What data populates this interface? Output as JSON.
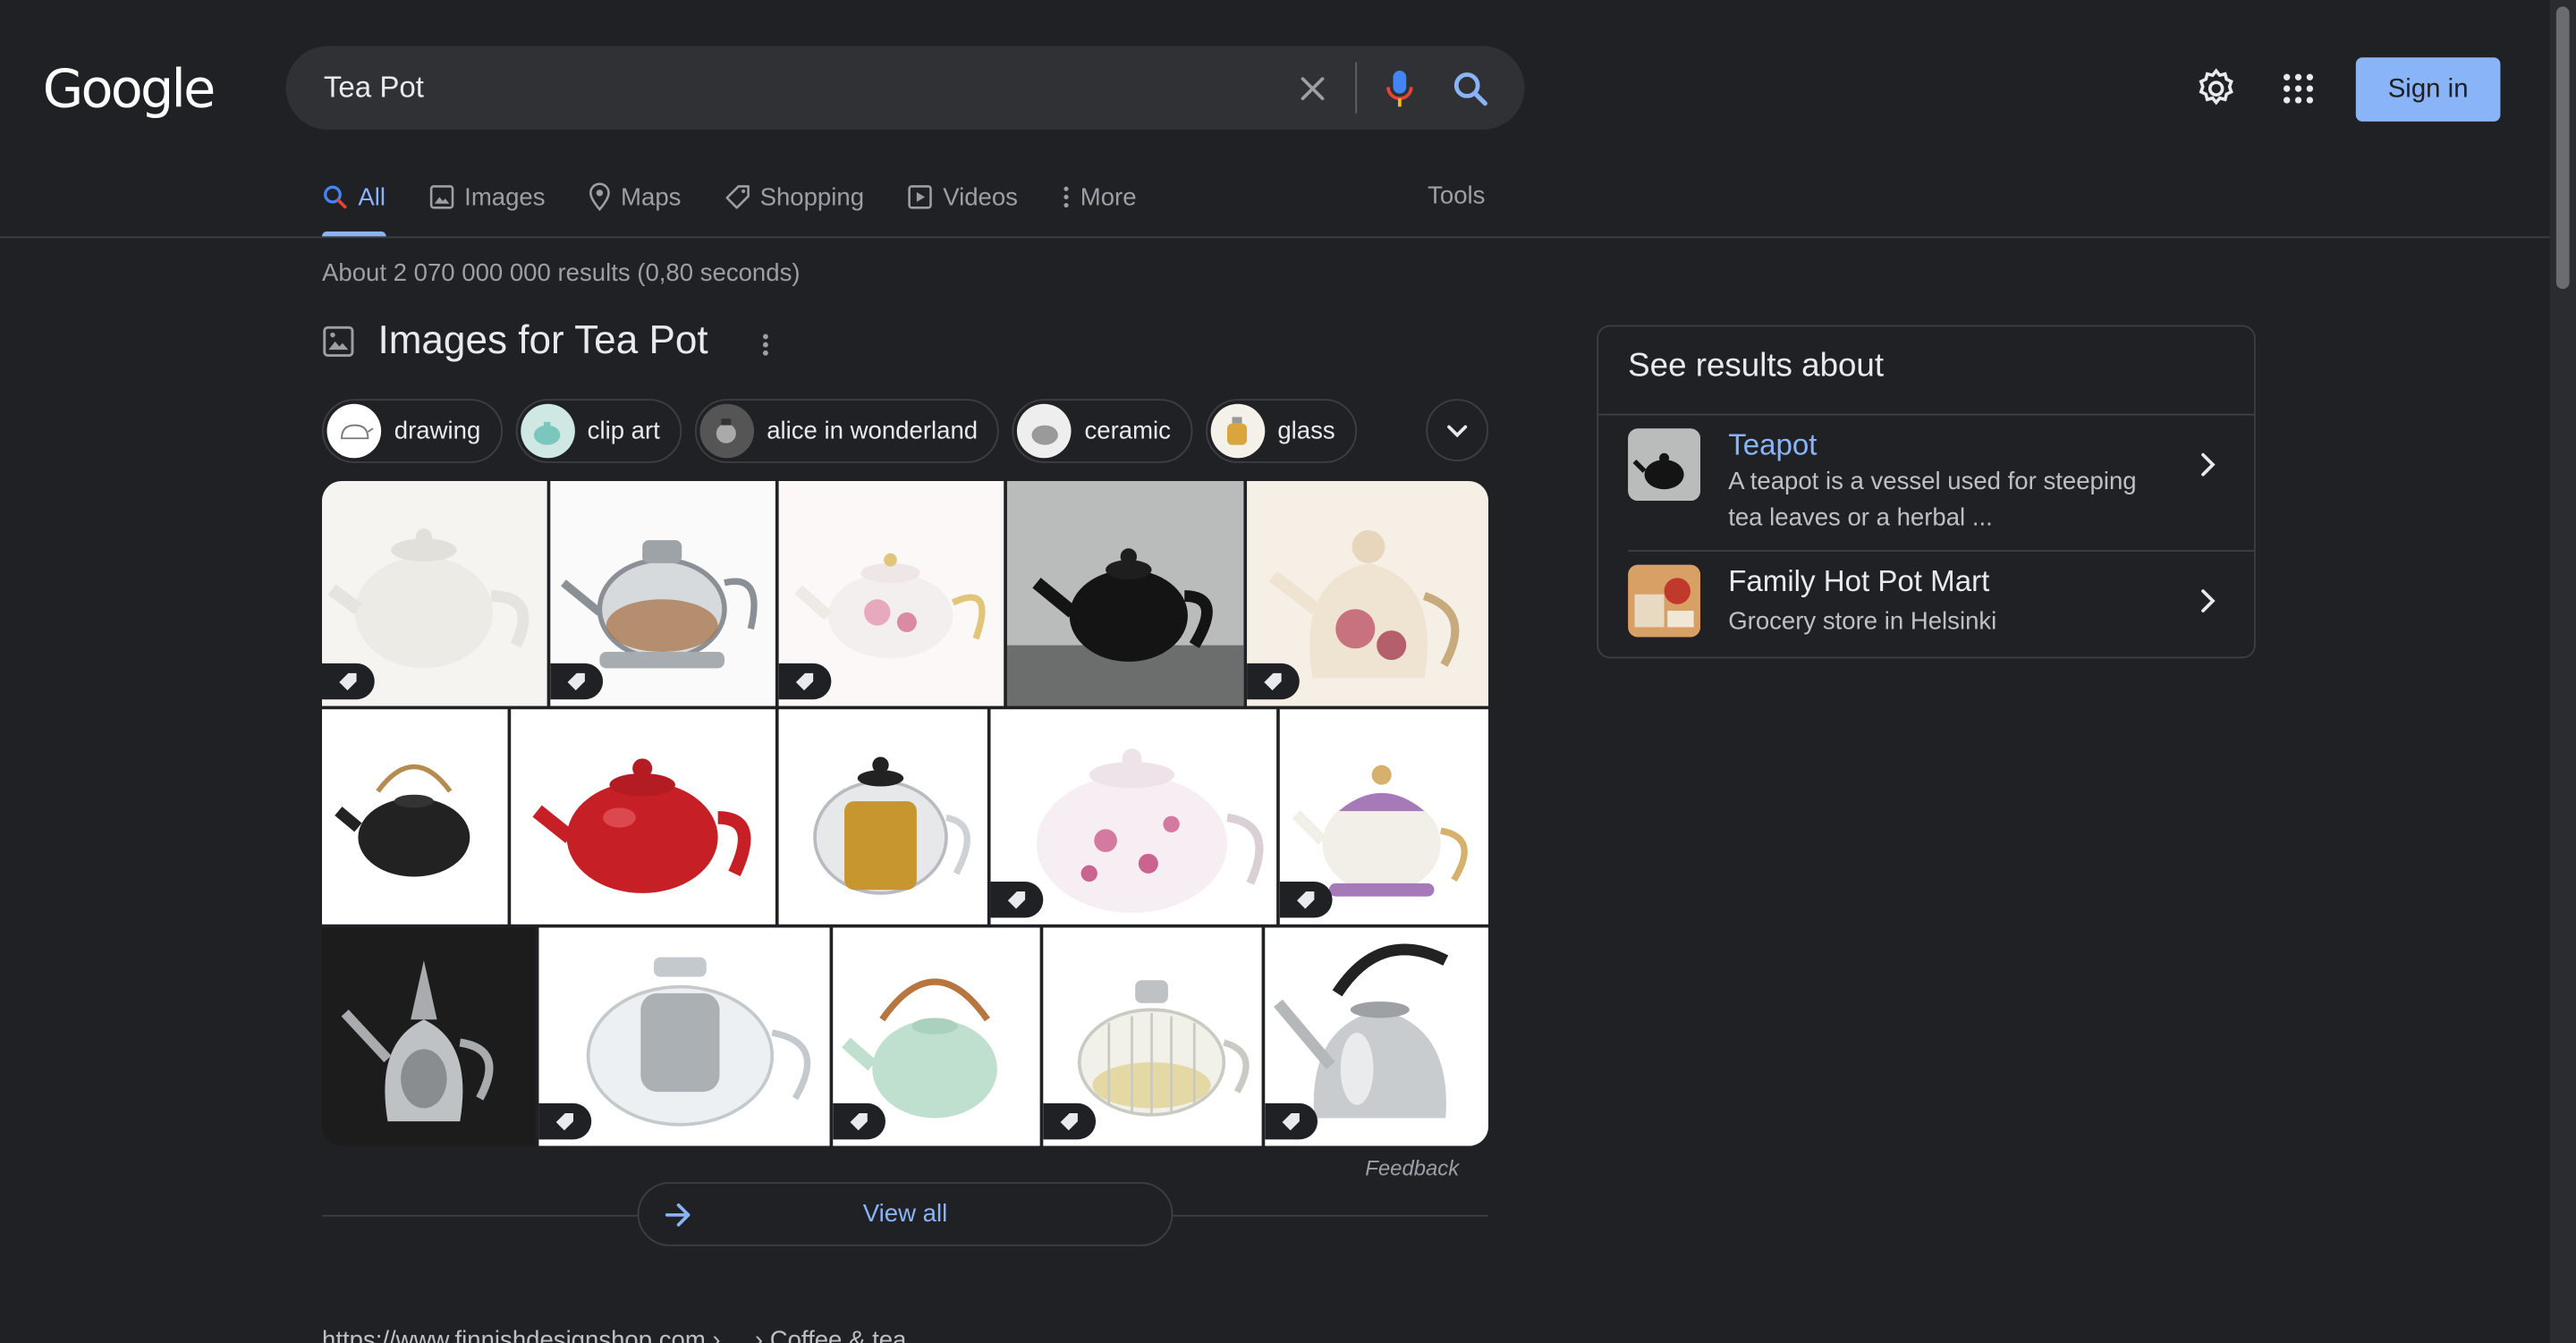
{
  "header": {
    "logo_text": "Google",
    "search_value": "Tea Pot",
    "sign_in_label": "Sign in"
  },
  "tabs": [
    {
      "label": "All",
      "icon": "search-icon",
      "active": true
    },
    {
      "label": "Images",
      "icon": "image-icon"
    },
    {
      "label": "Maps",
      "icon": "map-pin-icon"
    },
    {
      "label": "Shopping",
      "icon": "tag-icon"
    },
    {
      "label": "Videos",
      "icon": "play-icon"
    },
    {
      "label": "More",
      "icon": "more-vert-icon"
    }
  ],
  "tools_label": "Tools",
  "result_stats": "About 2 070 000 000 results (0,80 seconds)",
  "images_section": {
    "title": "Images for Tea Pot",
    "chips": [
      {
        "label": "drawing"
      },
      {
        "label": "clip art"
      },
      {
        "label": "alice in wonderland"
      },
      {
        "label": "ceramic"
      },
      {
        "label": "glass"
      }
    ],
    "feedback_label": "Feedback",
    "view_all_label": "View all"
  },
  "knowledge_panel": {
    "heading": "See results about",
    "items": [
      {
        "title": "Teapot",
        "description": "A teapot is a vessel used for steeping tea leaves or a herbal ..."
      },
      {
        "title": "Family Hot Pot Mart",
        "description": "Grocery store in Helsinki"
      }
    ]
  },
  "next_result_partial": "https://www.finnishdesignshop.com › ... › Coffee & tea",
  "colors": {
    "background": "#202124",
    "accent": "#8ab4f8",
    "text": "#e8eaed",
    "muted": "#9aa0a6"
  }
}
